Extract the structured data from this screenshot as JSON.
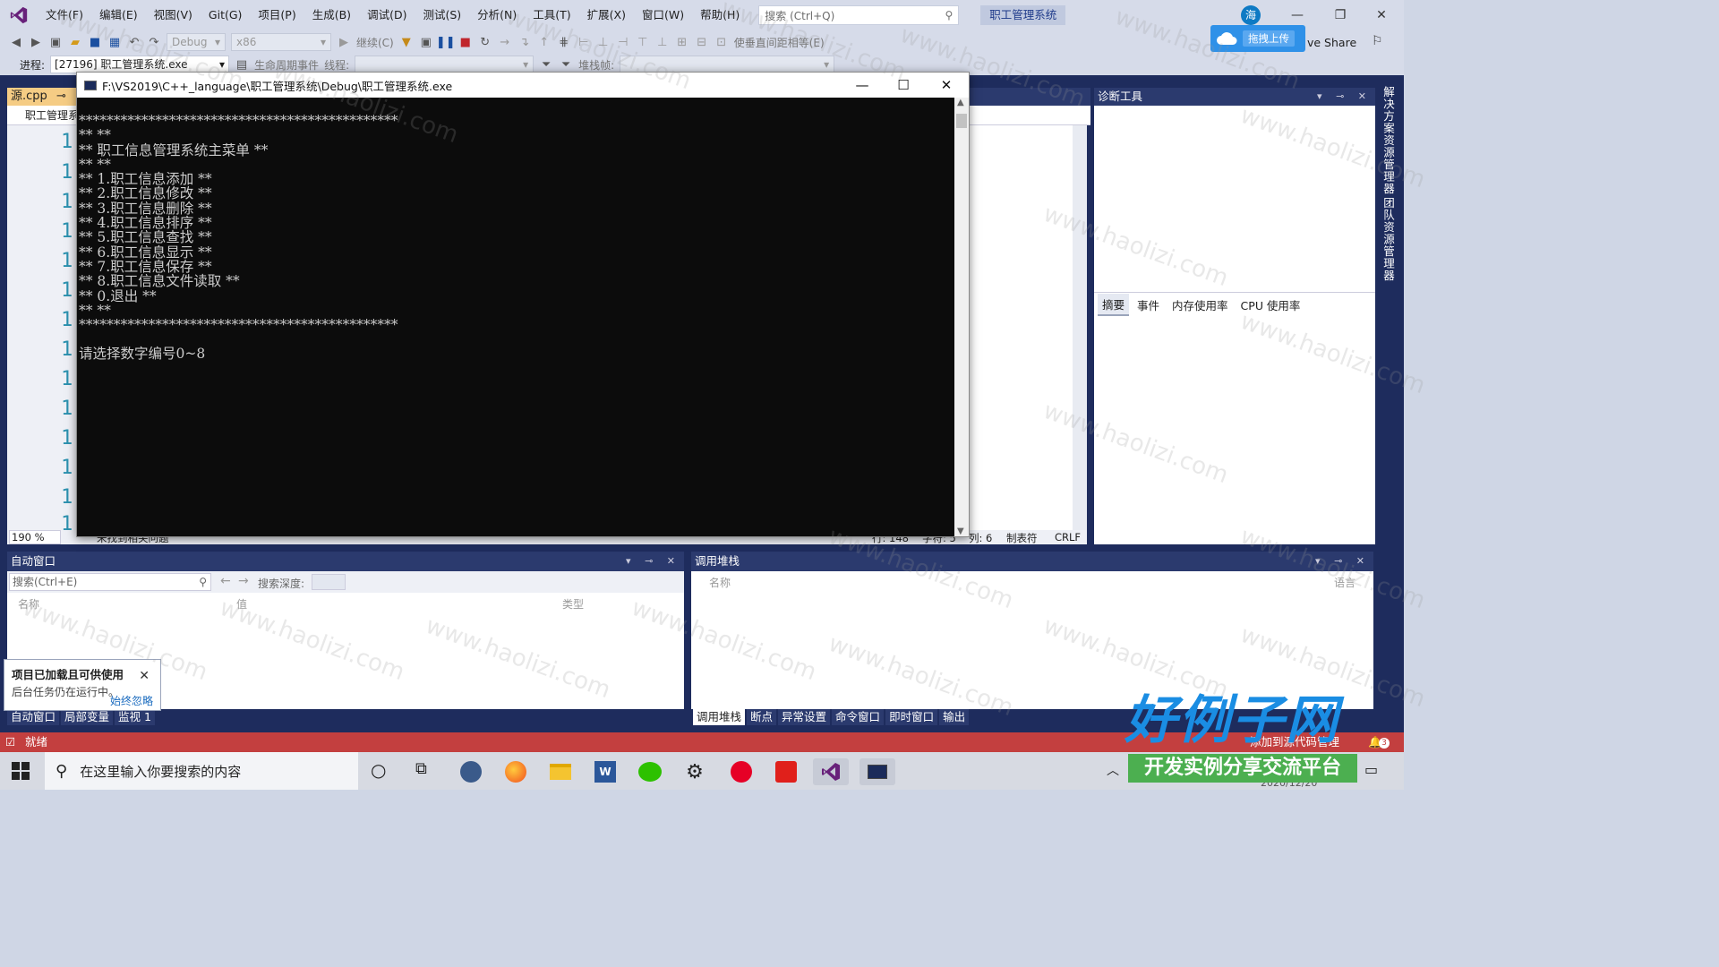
{
  "menubar": {
    "items": [
      "文件(F)",
      "编辑(E)",
      "视图(V)",
      "Git(G)",
      "项目(P)",
      "生成(B)",
      "调试(D)",
      "测试(S)",
      "分析(N)",
      "工具(T)",
      "扩展(X)",
      "窗口(W)",
      "帮助(H)"
    ],
    "search_placeholder": "搜索 (Ctrl+Q)",
    "solution_name": "职工管理系统",
    "avatar_letter": "海"
  },
  "toolbar": {
    "config": "Debug",
    "platform": "x86",
    "continue_label": "继续(C)",
    "spacing_label": "使垂直间距相等(E)",
    "upload_label": "拖拽上传",
    "live_share": "ve Share"
  },
  "toolbar2": {
    "process_label": "进程:",
    "process_value": "[27196] 职工管理系统.exe",
    "lifecycle_label": "生命周期事件",
    "thread_label": "线程:",
    "stackframe_label": "堆栈帧:"
  },
  "editor": {
    "tab_label": "源.cpp",
    "nav_label": "职工管理系",
    "line_prefix": "1",
    "zoom": "190 %",
    "issues": "未找到相关问题",
    "line": "行: 148",
    "char": "字符: 5",
    "col": "列: 6",
    "tabs": "制表符",
    "eol": "CRLF"
  },
  "diagnostics": {
    "title": "诊断工具",
    "tabs": [
      "摘要",
      "事件",
      "内存使用率",
      "CPU 使用率"
    ]
  },
  "side_labels": [
    "解决方案资源管理器",
    "团队资源管理器"
  ],
  "auto_window": {
    "title": "自动窗口",
    "search_placeholder": "搜索(Ctrl+E)",
    "depth_label": "搜索深度:",
    "columns": [
      "名称",
      "值",
      "类型"
    ],
    "tabs": [
      "自动窗口",
      "局部变量",
      "监视 1"
    ]
  },
  "call_stack": {
    "title": "调用堆栈",
    "columns": [
      "名称",
      "语言"
    ],
    "tabs": [
      "调用堆栈",
      "断点",
      "异常设置",
      "命令窗口",
      "即时窗口",
      "输出"
    ]
  },
  "toast": {
    "title": "项目已加载且可供使用",
    "body": "后台任务仍在运行中。",
    "link": "始终忽略"
  },
  "statusbar": {
    "ready": "就绪",
    "source_control": "添加到源代码管理",
    "notifications": "3"
  },
  "taskbar": {
    "search_placeholder": "在这里输入你要搜索的内容",
    "date_partial": "2020/12/20"
  },
  "console": {
    "title": "F:\\VS2019\\C++_language\\职工管理系统\\Debug\\职工管理系统.exe",
    "lines": [
      "**********************************************",
      "** **",
      "** 职工信息管理系统主菜单 **",
      "** **",
      "** 1.职工信息添加 **",
      "** 2.职工信息修改 **",
      "** 3.职工信息删除 **",
      "** 4.职工信息排序 **",
      "** 5.职工信息查找 **",
      "** 6.职工信息显示 **",
      "** 7.职工信息保存 **",
      "** 8.职工信息文件读取 **",
      "** 0.退出 **",
      "** **",
      "**********************************************",
      "",
      "请选择数字编号0~8"
    ]
  },
  "watermark": {
    "text": "www.haolizi.com",
    "brand_big": "好例子网",
    "brand_small": "开发实例分享交流平台"
  },
  "colors": {
    "vs_purple": "#68217a",
    "ide_dark": "#1e2c5d",
    "status_red": "#c33f3f",
    "brand_blue": "#1a8de3",
    "brand_green": "#4caf50"
  }
}
